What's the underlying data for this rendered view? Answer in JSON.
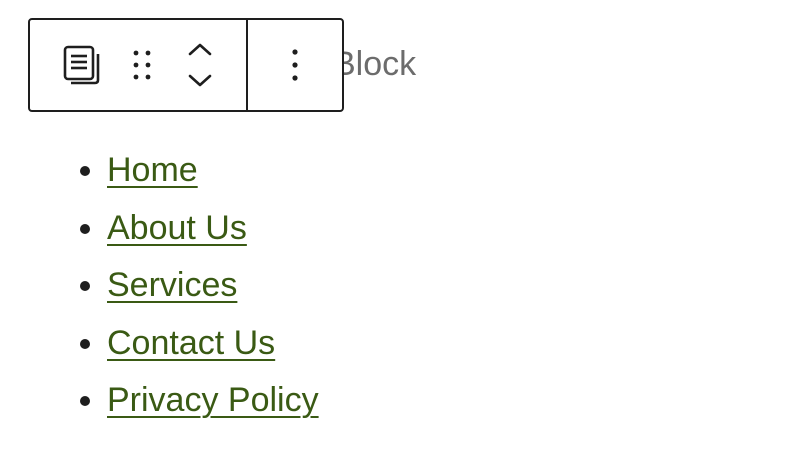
{
  "block": {
    "title_visible": "Block"
  },
  "toolbar": {
    "block_type_icon": "paragraph-block-icon",
    "drag_icon": "drag-handle-icon",
    "move_up_icon": "chevron-up-icon",
    "move_down_icon": "chevron-down-icon",
    "options_icon": "more-vertical-icon"
  },
  "nav": {
    "items": [
      {
        "label": "Home"
      },
      {
        "label": "About Us"
      },
      {
        "label": "Services"
      },
      {
        "label": "Contact Us"
      },
      {
        "label": "Privacy Policy"
      }
    ]
  },
  "colors": {
    "link": "#3a5a14",
    "toolbar_border": "#1e1e1e",
    "muted_text": "#6c6c6c"
  }
}
